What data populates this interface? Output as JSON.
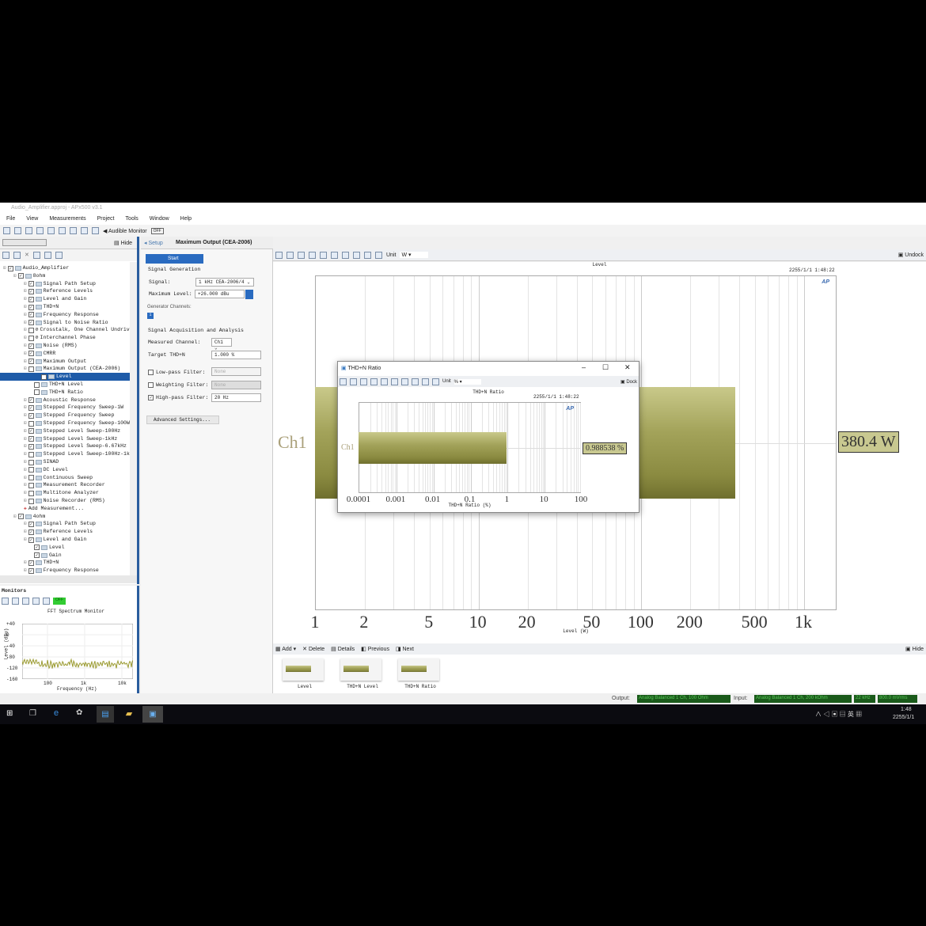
{
  "window": {
    "title": "Audio_Amplifier.approj - APx500 v3.1"
  },
  "menu": [
    "File",
    "View",
    "Measurements",
    "Project",
    "Tools",
    "Window",
    "Help"
  ],
  "toolbar": {
    "audible_monitor": "Audible Monitor",
    "off": "OFF"
  },
  "left_panel": {
    "hide": "Hide"
  },
  "tree": [
    {
      "label": "Audio_Amplifier",
      "level": 0,
      "check": true
    },
    {
      "label": "8ohm",
      "level": 1,
      "check": true
    },
    {
      "label": "Signal Path Setup",
      "level": 2,
      "check": true
    },
    {
      "label": "Reference Levels",
      "level": 2,
      "check": true
    },
    {
      "label": "Level and Gain",
      "level": 2,
      "check": true
    },
    {
      "label": "THD+N",
      "level": 2,
      "check": true
    },
    {
      "label": "Frequency Response",
      "level": 2,
      "check": true
    },
    {
      "label": "Signal to Noise Ratio",
      "level": 2,
      "check": true
    },
    {
      "label": "Crosstalk, One Channel Undriv",
      "level": 2,
      "check": false,
      "disabled": true
    },
    {
      "label": "Interchannel Phase",
      "level": 2,
      "check": false,
      "disabled": true
    },
    {
      "label": "Noise (RMS)",
      "level": 2,
      "check": true
    },
    {
      "label": "CMRR",
      "level": 2,
      "check": true
    },
    {
      "label": "Maximum Output",
      "level": 2,
      "check": true
    },
    {
      "label": "Maximum Output (CEA-2006)",
      "level": 2,
      "check": false
    },
    {
      "label": "Level",
      "level": 3,
      "check": false,
      "selected": true
    },
    {
      "label": "THD+N Level",
      "level": 3,
      "check": false
    },
    {
      "label": "THD+N Ratio",
      "level": 3,
      "check": false
    },
    {
      "label": "Acoustic Response",
      "level": 2,
      "check": true
    },
    {
      "label": "Stepped Frequency Sweep-1W",
      "level": 2,
      "check": true
    },
    {
      "label": "Stepped Frequency Sweep",
      "level": 2,
      "check": true
    },
    {
      "label": "Stepped Frequency Sweep-100W",
      "level": 2,
      "check": false
    },
    {
      "label": "Stepped Level Sweep-100Hz",
      "level": 2,
      "check": true
    },
    {
      "label": "Stepped Level Sweep-1kHz",
      "level": 2,
      "check": true
    },
    {
      "label": "Stepped Level Sweep-6.67kHz",
      "level": 2,
      "check": true
    },
    {
      "label": "Stepped Level Sweep-100Hz-1kH",
      "level": 2,
      "check": false
    },
    {
      "label": "SINAD",
      "level": 2,
      "check": false
    },
    {
      "label": "DC Level",
      "level": 2,
      "check": false
    },
    {
      "label": "Continuous Sweep",
      "level": 2,
      "check": false
    },
    {
      "label": "Measurement Recorder",
      "level": 2,
      "check": false
    },
    {
      "label": "Multitone Analyzer",
      "level": 2,
      "check": false
    },
    {
      "label": "Noise Recorder (RMS)",
      "level": 2,
      "check": false
    },
    {
      "label": "Add Measurement...",
      "level": 2,
      "add": true
    },
    {
      "label": "4ohm",
      "level": 1,
      "check": true
    },
    {
      "label": "Signal Path Setup",
      "level": 2,
      "check": true
    },
    {
      "label": "Reference Levels",
      "level": 2,
      "check": true
    },
    {
      "label": "Level and Gain",
      "level": 2,
      "check": true
    },
    {
      "label": "Level",
      "level": 3,
      "check": true
    },
    {
      "label": "Gain",
      "level": 3,
      "check": true
    },
    {
      "label": "THD+N",
      "level": 2,
      "check": true
    },
    {
      "label": "Frequency Response",
      "level": 2,
      "check": true
    }
  ],
  "monitors": {
    "title": "Monitors",
    "off": "OFF",
    "chart_title": "FFT Spectrum Monitor",
    "ylabel": "Level (dBu)",
    "xlabel": "Frequency (Hz)",
    "yticks": [
      "+40",
      "0",
      "-40",
      "-80",
      "-120",
      "-160"
    ],
    "xticks": [
      "100",
      "1k",
      "10k"
    ]
  },
  "setup": {
    "tab": "Setup",
    "title": "Maximum Output (CEA-2006)",
    "start": "Start",
    "sig_gen": "Signal Generation",
    "signal_label": "Signal:",
    "signal_value": "1 kHz CEA-2006/4",
    "max_level_label": "Maximum Level:",
    "max_level_value": "+26.000 dBu",
    "gen_channels": "Generator Channels:",
    "gen_ch_btn": "1",
    "acq": "Signal Acquisition and Analysis",
    "meas_ch_label": "Measured Channel:",
    "meas_ch_value": "Ch1",
    "target_label": "Target THD+N",
    "target_value": "1.000 %",
    "lp_label": "Low-pass Filter:",
    "lp_value": "None",
    "w_label": "Weighting Filter:",
    "w_value": "None",
    "hp_label": "High-pass Filter:",
    "hp_value": "20 Hz",
    "advanced": "Advanced Settings..."
  },
  "graph_toolbar": {
    "unit_label": "Unit",
    "unit_value": "W",
    "undock": "Undock"
  },
  "chart_data": [
    {
      "type": "bar",
      "orientation": "horizontal",
      "title": "Level",
      "timestamp": "2255/1/1 1:48:22",
      "categories": [
        "Ch1"
      ],
      "values": [
        380.4
      ],
      "value_label": "380.4 W",
      "xlabel": "Level (W)",
      "xscale": "log",
      "xlim": [
        1,
        1600
      ],
      "xticks": [
        "1",
        "2",
        "5",
        "10",
        "20",
        "50",
        "100",
        "200",
        "500",
        "1k"
      ],
      "xtick_values": [
        1,
        2,
        5,
        10,
        20,
        50,
        100,
        200,
        500,
        1000
      ]
    },
    {
      "type": "bar",
      "orientation": "horizontal",
      "title": "THD+N Ratio",
      "timestamp": "2255/1/1 1:48:22",
      "categories": [
        "Ch1"
      ],
      "values": [
        0.988538
      ],
      "value_label": "0.988538 %",
      "xlabel": "THD+N Ratio (%)",
      "xscale": "log",
      "xlim": [
        0.0001,
        100
      ],
      "xticks": [
        "0.0001",
        "0.001",
        "0.01",
        "0.1",
        "1",
        "10",
        "100"
      ],
      "xtick_values": [
        0.0001,
        0.001,
        0.01,
        0.1,
        1,
        10,
        100
      ]
    }
  ],
  "popup": {
    "title": "THD+N Ratio",
    "unit_label": "Unit",
    "unit_value": "%",
    "dock": "Dock",
    "logo": "AP"
  },
  "nav": {
    "add": "Add",
    "delete": "Delete",
    "details": "Details",
    "previous": "Previous",
    "next": "Next",
    "hide": "Hide"
  },
  "thumbnails": [
    "Level",
    "THD+N Level",
    "THD+N Ratio"
  ],
  "status": {
    "output_label": "Output:",
    "output_value": "Analog Balanced 1 Ch, 100 Ohm",
    "input_label": "Input:",
    "input_value": "Analog Balanced 1 Ch, 200 kOhm",
    "rate": "22 kHz",
    "level": "800.0 mVrms"
  },
  "taskbar": {
    "time": "1:48",
    "date": "2255/1/1",
    "ime": "英"
  },
  "colors": {
    "bar": "#a3a35a",
    "selection": "#1e5ba8",
    "accent": "#2a5d9e"
  }
}
